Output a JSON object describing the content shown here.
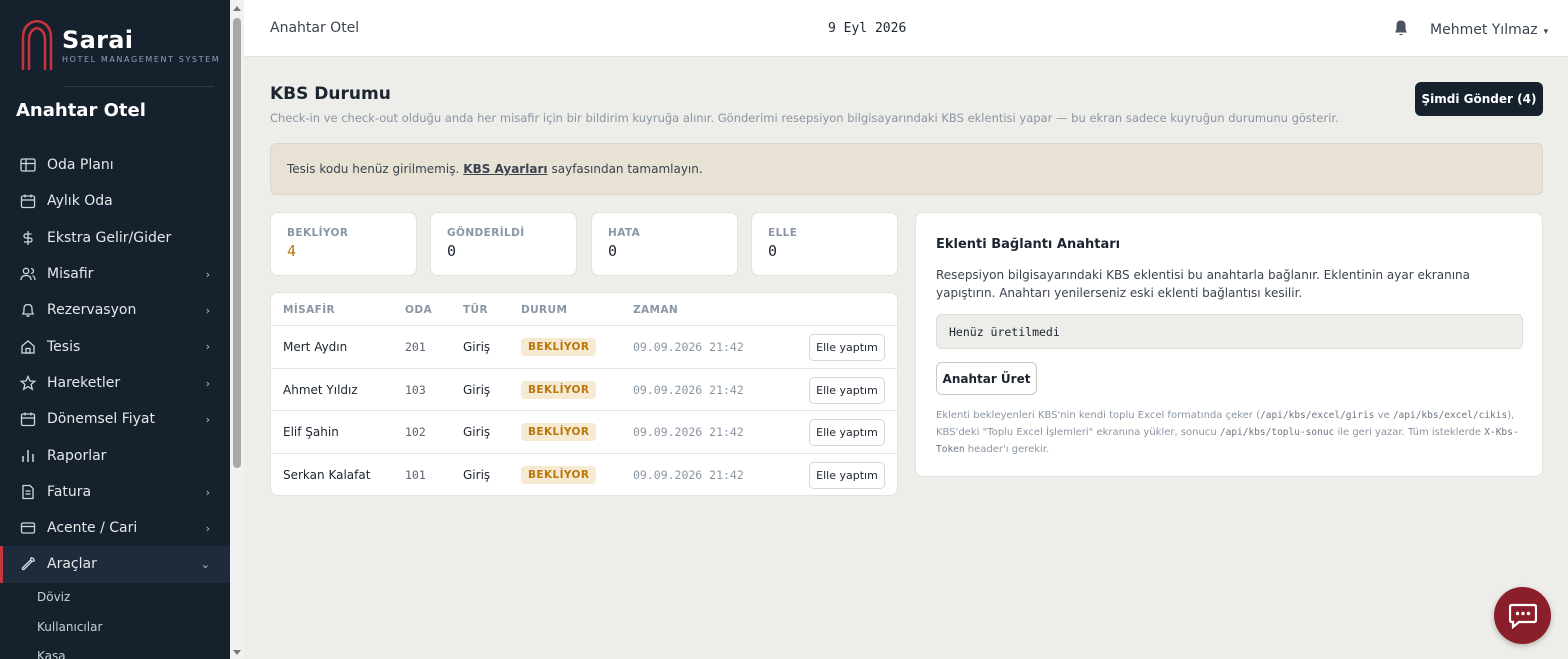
{
  "brand": {
    "name": "Sarai",
    "subtitle": "HOTEL MANAGEMENT SYSTEM"
  },
  "sidebar": {
    "hotel_name": "Anahtar Otel",
    "items": [
      {
        "label": "Oda Planı",
        "icon": "grid-icon",
        "has_chevron": false
      },
      {
        "label": "Aylık Oda",
        "icon": "calendar-icon",
        "has_chevron": false
      },
      {
        "label": "Ekstra Gelir/Gider",
        "icon": "dollar-icon",
        "has_chevron": false
      },
      {
        "label": "Misafir",
        "icon": "users-icon",
        "has_chevron": true
      },
      {
        "label": "Rezervasyon",
        "icon": "bell-icon",
        "has_chevron": true
      },
      {
        "label": "Tesis",
        "icon": "home-icon",
        "has_chevron": true
      },
      {
        "label": "Hareketler",
        "icon": "star-icon",
        "has_chevron": true
      },
      {
        "label": "Dönemsel Fiyat",
        "icon": "calendar-icon",
        "has_chevron": true
      },
      {
        "label": "Raporlar",
        "icon": "bar-chart-icon",
        "has_chevron": false
      },
      {
        "label": "Fatura",
        "icon": "file-icon",
        "has_chevron": true
      },
      {
        "label": "Acente / Cari",
        "icon": "card-icon",
        "has_chevron": true
      },
      {
        "label": "Araçlar",
        "icon": "wrench-icon",
        "has_chevron": true,
        "active": true
      }
    ],
    "sub_items": [
      "Döviz",
      "Kullanıcılar",
      "Kasa"
    ]
  },
  "topbar": {
    "title": "Anahtar Otel",
    "date": "9 Eyl 2026",
    "user": "Mehmet Yılmaz",
    "caret": "▾"
  },
  "page": {
    "title": "KBS Durumu",
    "description": "Check-in ve check-out olduğu anda her misafir için bir bildirim kuyruğa alınır. Gönderimi resepsiyon bilgisayarındaki KBS eklentisi yapar — bu ekran sadece kuyruğun durumunu gösterir.",
    "send_button": "Şimdi Gönder (4)"
  },
  "alert": {
    "before": "Tesis kodu henüz girilmemiş.",
    "link": "KBS Ayarları",
    "after": "sayfasından tamamlayın."
  },
  "stats": [
    {
      "label": "BEKLİYOR",
      "value": "4"
    },
    {
      "label": "GÖNDERİLDİ",
      "value": "0"
    },
    {
      "label": "HATA",
      "value": "0"
    },
    {
      "label": "ELLE",
      "value": "0"
    }
  ],
  "table": {
    "headers": [
      "MİSAFİR",
      "ODA",
      "TÜR",
      "DURUM",
      "ZAMAN"
    ],
    "rows": [
      {
        "guest": "Mert Aydın",
        "room": "201",
        "type": "Giriş",
        "status": "BEKLİYOR",
        "time": "09.09.2026 21:42",
        "action": "Elle yaptım"
      },
      {
        "guest": "Ahmet Yıldız",
        "room": "103",
        "type": "Giriş",
        "status": "BEKLİYOR",
        "time": "09.09.2026 21:42",
        "action": "Elle yaptım"
      },
      {
        "guest": "Elif Şahin",
        "room": "102",
        "type": "Giriş",
        "status": "BEKLİYOR",
        "time": "09.09.2026 21:42",
        "action": "Elle yaptım"
      },
      {
        "guest": "Serkan Kalafat",
        "room": "101",
        "type": "Giriş",
        "status": "BEKLİYOR",
        "time": "09.09.2026 21:42",
        "action": "Elle yaptım"
      }
    ]
  },
  "key_card": {
    "title": "Eklenti Bağlantı Anahtarı",
    "description": "Resepsiyon bilgisayarındaki KBS eklentisi bu anahtarla bağlanır. Eklentinin ayar ekranına yapıştırın. Anahtarı yenilerseniz eski eklenti bağlantısı kesilir.",
    "key_value": "Henüz üretilmedi",
    "button": "Anahtar Üret",
    "note": {
      "t1": "Eklenti bekleyenleri KBS'nin kendi toplu Excel formatında çeker (",
      "c1": "/api/kbs/excel/giris",
      "t2": " ve ",
      "c2": "/api/kbs/excel/cikis",
      "t3": "), KBS'deki \"Toplu Excel İşlemleri\" ekranına yükler, sonucu ",
      "c3": "/api/kbs/toplu-sonuc",
      "t4": " ile geri yazar. Tüm isteklerde ",
      "c4": "X-Kbs-Token",
      "t5": " header'ı gerekir."
    }
  },
  "colors": {
    "sidebar_bg": "#16212e",
    "accent": "#8b1e2b",
    "warning": "#b9770e",
    "page_bg": "#edede9"
  }
}
